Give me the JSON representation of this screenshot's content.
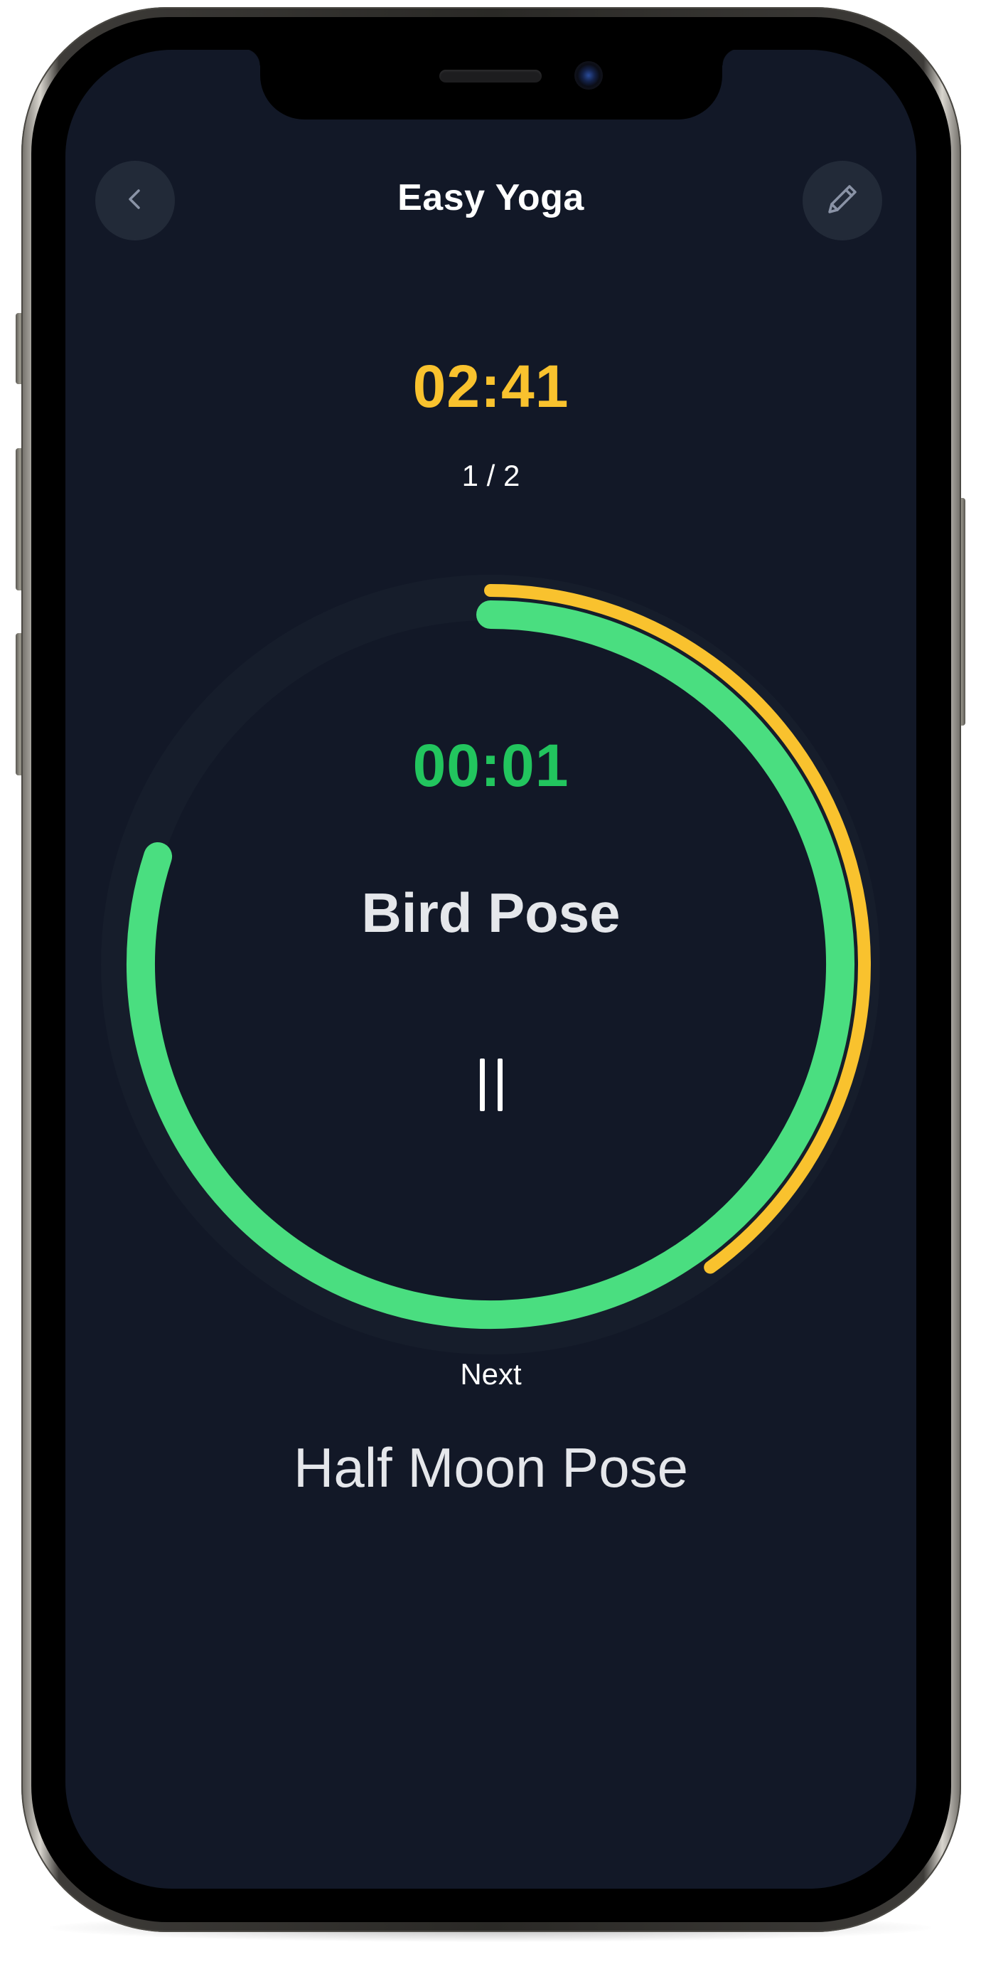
{
  "header": {
    "title": "Easy Yoga",
    "back_icon": "chevron-left-icon",
    "edit_icon": "pencil-icon"
  },
  "session": {
    "total_remaining": "02:41",
    "set_counter": "1 / 2"
  },
  "current_pose": {
    "time": "00:01",
    "name": "Bird Pose",
    "control_icon": "pause-icon"
  },
  "progress": {
    "pose_fraction_complete": 0.8,
    "session_fraction_complete": 0.4
  },
  "next": {
    "label": "Next",
    "pose_name": "Half Moon Pose"
  },
  "colors": {
    "background": "#121827",
    "button_bg": "#222a38",
    "ring_track": "#161d2b",
    "session_ring": "#f9c22e",
    "pose_ring": "#4ade80",
    "pose_timer_text": "#22c55e",
    "total_timer_text": "#f9c22e"
  }
}
